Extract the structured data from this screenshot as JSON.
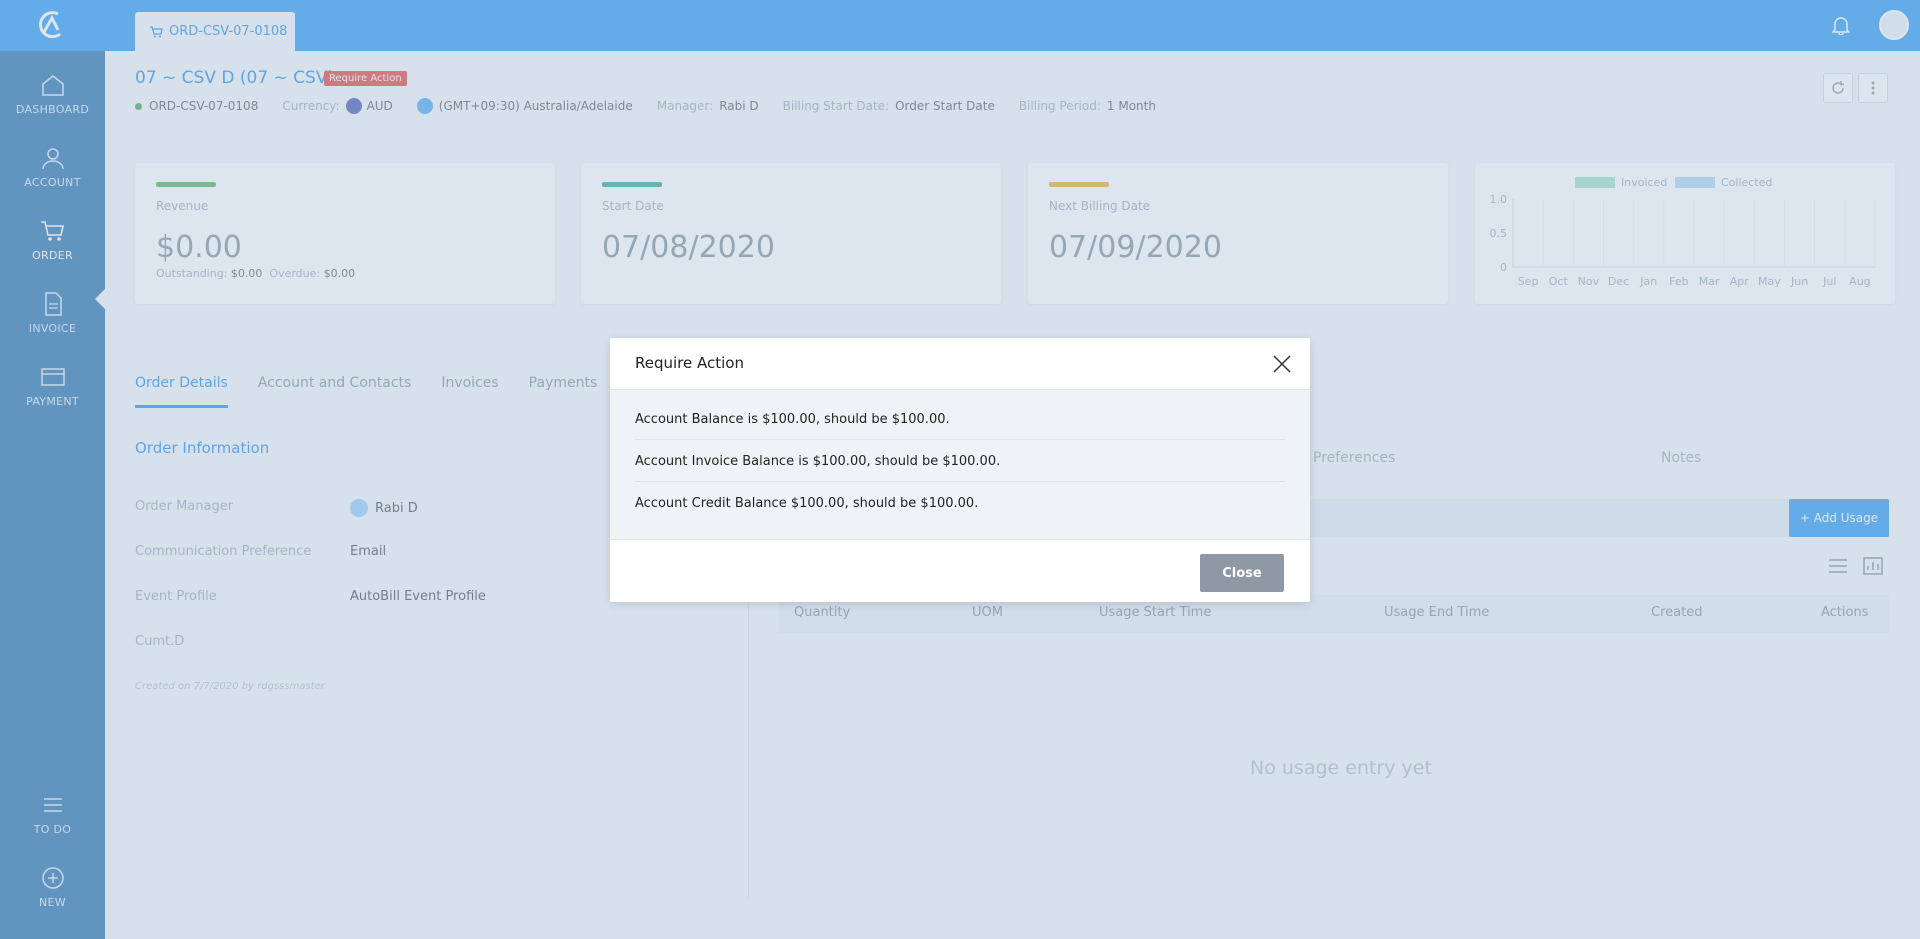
{
  "topbar": {
    "tab_label": "ORD-CSV-07-0108"
  },
  "sidebar": {
    "items": [
      {
        "label": "DASHBOARD"
      },
      {
        "label": "ACCOUNT"
      },
      {
        "label": "ORDER"
      },
      {
        "label": "INVOICE"
      },
      {
        "label": "PAYMENT"
      },
      {
        "label": "TO DO"
      },
      {
        "label": "NEW"
      }
    ]
  },
  "header": {
    "title": "07 ~ CSV D (07 ~ CSV)",
    "badge": "Require Action",
    "order_id": "ORD-CSV-07-0108",
    "currency_label": "Currency:",
    "currency_value": "AUD",
    "timezone": "(GMT+09:30) Australia/Adelaide",
    "manager_label": "Manager:",
    "manager_value": "Rabi D",
    "billing_start_label": "Billing Start Date:",
    "billing_start_value": "Order Start Date",
    "billing_period_label": "Billing Period:",
    "billing_period_value": "1 Month"
  },
  "cards": {
    "revenue": {
      "label": "Revenue",
      "value": "$0.00",
      "outstanding_label": "Outstanding:",
      "outstanding_value": "$0.00",
      "overdue_label": "Overdue:",
      "overdue_value": "$0.00"
    },
    "start": {
      "label": "Start Date",
      "value": "07/08/2020"
    },
    "next": {
      "label": "Next Billing Date",
      "value": "07/09/2020"
    }
  },
  "chart_data": {
    "type": "bar",
    "categories": [
      "Sep",
      "Oct",
      "Nov",
      "Dec",
      "Jan",
      "Feb",
      "Mar",
      "Apr",
      "May",
      "Jun",
      "Jul",
      "Aug"
    ],
    "series": [
      {
        "name": "Invoiced",
        "values": [
          0,
          0,
          0,
          0,
          0,
          0,
          0,
          0,
          0,
          0,
          0,
          0
        ],
        "color": "#9ddfc8"
      },
      {
        "name": "Collected",
        "values": [
          0,
          0,
          0,
          0,
          0,
          0,
          0,
          0,
          0,
          0,
          0,
          0
        ],
        "color": "#a9d3f5"
      }
    ],
    "yticks": [
      "1.0",
      "0.5",
      "0"
    ],
    "ylim": [
      0,
      1.0
    ]
  },
  "tabs": [
    {
      "label": "Order Details"
    },
    {
      "label": "Account and Contacts"
    },
    {
      "label": "Invoices"
    },
    {
      "label": "Payments"
    }
  ],
  "order_info": {
    "title": "Order Information",
    "rows": [
      {
        "key": "Order Manager",
        "value": "Rabi D"
      },
      {
        "key": "Communication Preference",
        "value": "Email"
      },
      {
        "key": "Event Profile",
        "value": "AutoBill Event Profile"
      },
      {
        "key": "Cumt.D",
        "value": ""
      }
    ],
    "created": "Created on 7/7/2020 by rdgsssmaster"
  },
  "right_panel": {
    "tab_preferences": "Preferences",
    "tab_notes": "Notes",
    "add_usage": "+ Add Usage",
    "columns": [
      "Quantity",
      "UOM",
      "Usage Start Time",
      "Usage End Time",
      "Created",
      "Actions"
    ],
    "empty_text": "No usage entry yet"
  },
  "modal": {
    "title": "Require Action",
    "messages": [
      "Account Balance is $100.00, should be $100.00.",
      "Account Invoice Balance is $100.00, should be $100.00.",
      "Account Credit Balance $100.00, should be $100.00."
    ],
    "close_label": "Close"
  }
}
